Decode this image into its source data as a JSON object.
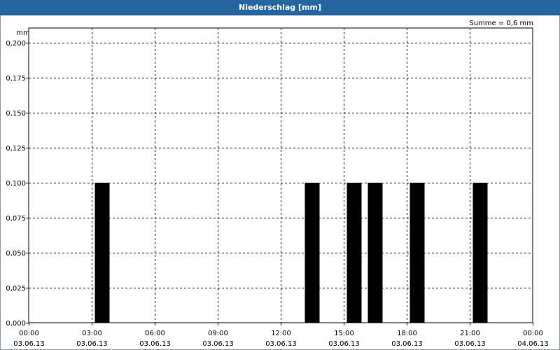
{
  "window": {
    "title": "Niederschlag [mm]"
  },
  "chart_data": {
    "type": "bar",
    "title": "Niederschlag [mm]",
    "ylabel": "mm",
    "annotation": "Summe = 0,6 mm",
    "ylim": [
      0,
      0.2
    ],
    "ytick_values": [
      0,
      0.025,
      0.05,
      0.075,
      0.1,
      0.125,
      0.15,
      0.175,
      0.2
    ],
    "ytick_labels": [
      "0,000",
      "0,025",
      "0,050",
      "0,075",
      "0,100",
      "0,125",
      "0,150",
      "0,175",
      "0,200"
    ],
    "xlim_hours": [
      0,
      24
    ],
    "xtick_hours": [
      0,
      3,
      6,
      9,
      12,
      15,
      18,
      21,
      24
    ],
    "xtick_labels": [
      [
        "00:00",
        "03.06.13"
      ],
      [
        "03:00",
        "03.06.13"
      ],
      [
        "06:00",
        "03.06.13"
      ],
      [
        "09:00",
        "03.06.13"
      ],
      [
        "12:00",
        "03.06.13"
      ],
      [
        "15:00",
        "03.06.13"
      ],
      [
        "18:00",
        "03.06.13"
      ],
      [
        "21:00",
        "03.06.13"
      ],
      [
        "00:00",
        "04.06.13"
      ]
    ],
    "bar_interval_hours": 1,
    "bars": [
      {
        "start": "03.06.13 03:00",
        "end": "03.06.13 04:00",
        "hour": 3,
        "value": 0.1
      },
      {
        "start": "03.06.13 13:00",
        "end": "03.06.13 14:00",
        "hour": 13,
        "value": 0.1
      },
      {
        "start": "03.06.13 15:00",
        "end": "03.06.13 16:00",
        "hour": 15,
        "value": 0.1
      },
      {
        "start": "03.06.13 16:00",
        "end": "03.06.13 17:00",
        "hour": 16,
        "value": 0.1
      },
      {
        "start": "03.06.13 18:00",
        "end": "03.06.13 19:00",
        "hour": 18,
        "value": 0.1
      },
      {
        "start": "03.06.13 21:00",
        "end": "03.06.13 22:00",
        "hour": 21,
        "value": 0.1
      }
    ],
    "grid": true,
    "bar_color": "#000000"
  }
}
